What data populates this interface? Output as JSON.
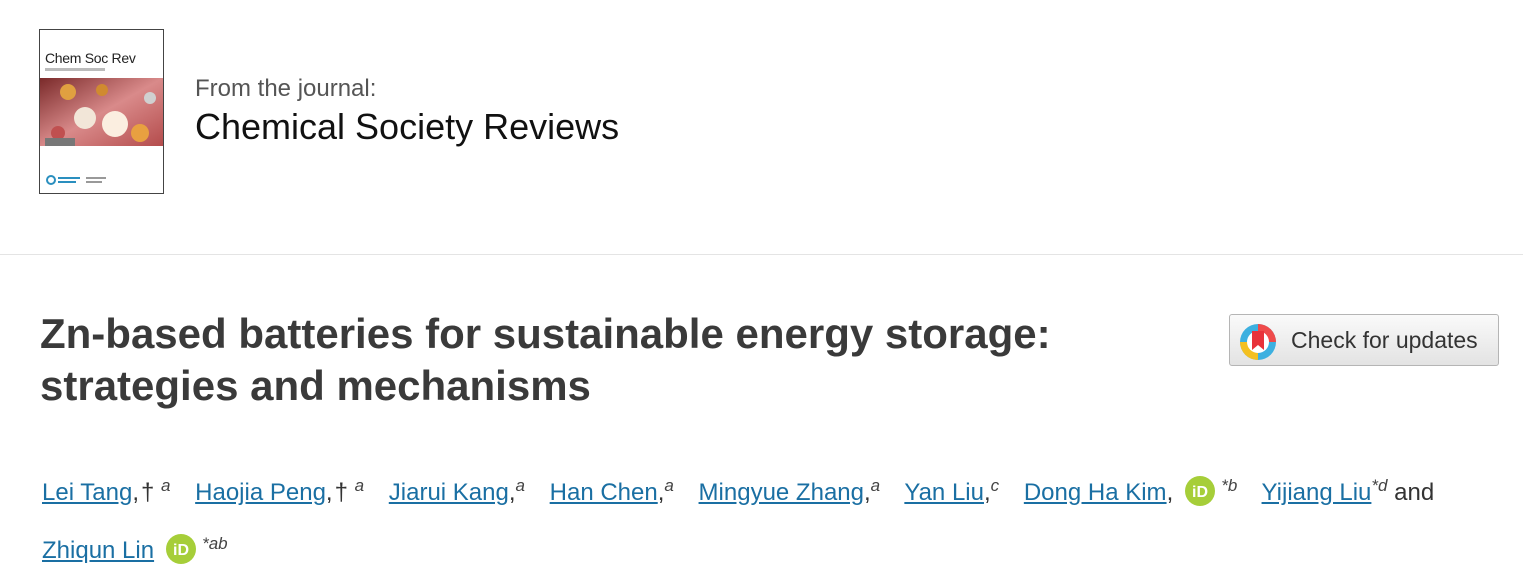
{
  "journal": {
    "cover_title": "Chem Soc Rev",
    "from_label": "From the journal:",
    "name": "Chemical Society Reviews"
  },
  "article": {
    "title_line1": "Zn-based batteries for sustainable energy storage:",
    "title_line2": "strategies and mechanisms"
  },
  "check_updates": {
    "label": "Check for updates",
    "icon": "crossmark-icon"
  },
  "authors": [
    {
      "name": "Lei Tang",
      "dagger": "†",
      "sup": "a",
      "orcid": false
    },
    {
      "name": "Haojia Peng",
      "dagger": "†",
      "sup": "a",
      "orcid": false
    },
    {
      "name": "Jiarui Kang",
      "sup": "a",
      "orcid": false
    },
    {
      "name": "Han Chen",
      "sup": "a",
      "orcid": false
    },
    {
      "name": "Mingyue Zhang",
      "sup": "a",
      "orcid": false
    },
    {
      "name": "Yan Liu",
      "sup": "c",
      "orcid": false
    },
    {
      "name": "Dong Ha Kim",
      "sup": "*b",
      "orcid": true
    },
    {
      "name": "Yijiang Liu",
      "sup": "*d",
      "orcid": false
    },
    {
      "name": "Zhiqun Lin",
      "sup": "*ab",
      "orcid": true
    }
  ],
  "and_text": "and",
  "colors": {
    "link": "#1a6fa3",
    "orcid": "#a6ce39",
    "title": "#3a3a3a"
  }
}
